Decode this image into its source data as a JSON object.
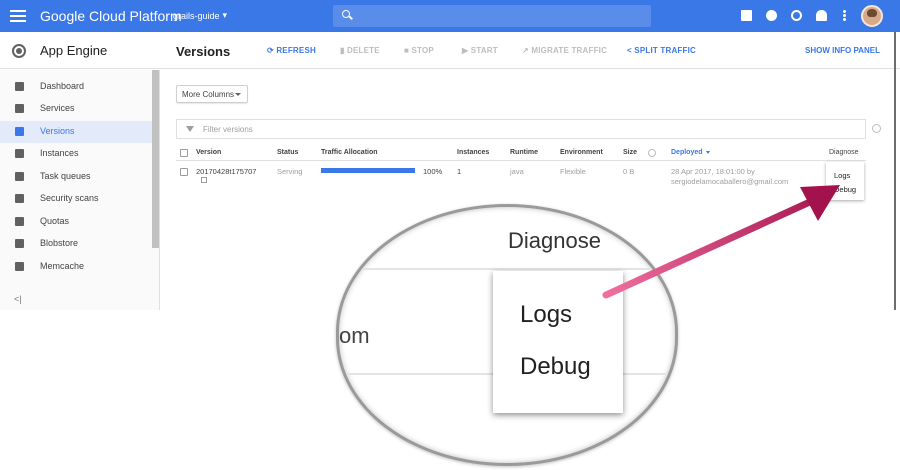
{
  "topbar": {
    "title": "Google Cloud Platform",
    "project": "grails-guide",
    "icons": [
      "cloud-shell-icon",
      "notifications-chat-icon",
      "help-icon",
      "bell-icon",
      "more-vert-icon"
    ]
  },
  "nav": {
    "title": "App Engine",
    "collapse": "<|",
    "items": [
      {
        "label": "Dashboard",
        "icon": "dashboard-icon"
      },
      {
        "label": "Services",
        "icon": "services-icon"
      },
      {
        "label": "Versions",
        "icon": "versions-icon"
      },
      {
        "label": "Instances",
        "icon": "instances-icon"
      },
      {
        "label": "Task queues",
        "icon": "task-queues-icon"
      },
      {
        "label": "Security scans",
        "icon": "security-scans-icon"
      },
      {
        "label": "Quotas",
        "icon": "quotas-icon"
      },
      {
        "label": "Blobstore",
        "icon": "blobstore-icon"
      },
      {
        "label": "Memcache",
        "icon": "memcache-icon"
      }
    ],
    "active": "Versions"
  },
  "header": {
    "page_title": "Versions",
    "refresh": "REFRESH",
    "delete": "DELETE",
    "stop": "STOP",
    "start": "START",
    "migrate": "MIGRATE TRAFFIC",
    "split": "SPLIT TRAFFIC",
    "info_panel": "SHOW INFO PANEL"
  },
  "toolbar": {
    "more_columns": "More Columns",
    "filter_placeholder": "Filter versions"
  },
  "table": {
    "columns": {
      "version": "Version",
      "status": "Status",
      "traffic": "Traffic Allocation",
      "instances": "Instances",
      "runtime": "Runtime",
      "environment": "Environment",
      "size": "Size",
      "deployed": "Deployed",
      "diagnose": "Diagnose"
    },
    "row": {
      "version": "20170428t175707",
      "status": "Serving",
      "traffic_pct": "100%",
      "traffic_fraction": 1.0,
      "instances": "1",
      "runtime": "java",
      "environment": "Flexible",
      "size": "0 B",
      "deployed_line1": "28 Apr 2017, 18:01:00 by",
      "deployed_line2": "sergiodelamocaballero@gmail.com",
      "diagnose_logs": "Logs",
      "diagnose_debug": "Debug"
    }
  },
  "zoom": {
    "heading": "Diagnose",
    "fragment": "om",
    "logs": "Logs",
    "debug": "Debug"
  },
  "colors": {
    "appbar": "#3b78e7",
    "accent": "#3b78e7",
    "arrow": "#c4185c"
  }
}
